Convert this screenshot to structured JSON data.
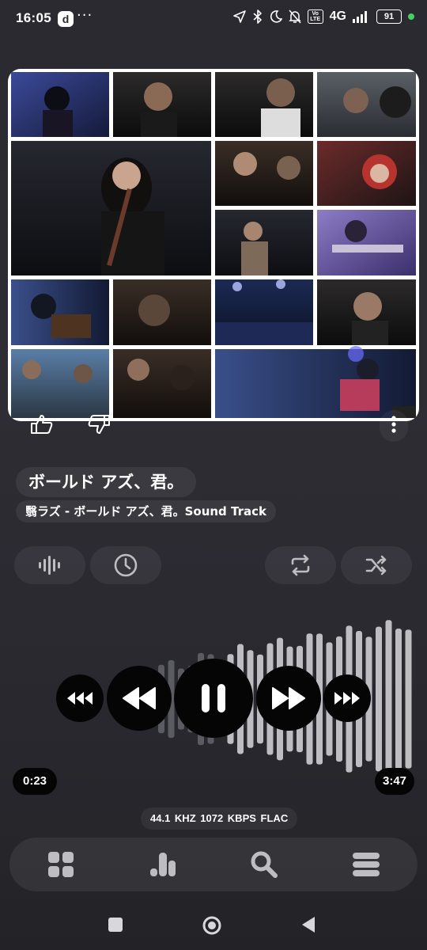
{
  "status_bar": {
    "time": "16:05",
    "app_icon_letter": "d",
    "more_glyph": "···",
    "icons": [
      "location-arrow-icon",
      "bluetooth-icon",
      "moon-icon",
      "bell-off-icon",
      "volte-icon",
      "signal-icon"
    ],
    "volte_label": "Vo LTE",
    "network": "4G",
    "battery": "91"
  },
  "album_art": {
    "description_icon": "album-collage-image"
  },
  "track": {
    "title": "ボールド アズ、君。",
    "subtitle": "翳ラズ - ボールド アズ、君。Sound Track"
  },
  "playback": {
    "elapsed": "0:23",
    "duration": "3:47",
    "progress_fraction": 0.1,
    "quality": {
      "sample_rate": "44.1 KHZ",
      "bitrate": "1072 KBPS",
      "format": "FLAC"
    },
    "state": "playing"
  },
  "chips": [
    "equalizer-icon",
    "sleep-timer-icon",
    "repeat-icon",
    "shuffle-icon"
  ],
  "controls": [
    "fast-rewind-button",
    "previous-button",
    "pause-button",
    "next-button",
    "fast-forward-button"
  ],
  "bottom_nav": [
    "library-grid-icon",
    "charts-icon",
    "search-icon",
    "queue-menu-icon"
  ],
  "colors": {
    "background": "#2a2a30",
    "control_bg": "#050505",
    "waveform_played": "#5b5b62",
    "waveform_unplayed": "#bdbdc2",
    "accent_green": "#3fd35f"
  }
}
